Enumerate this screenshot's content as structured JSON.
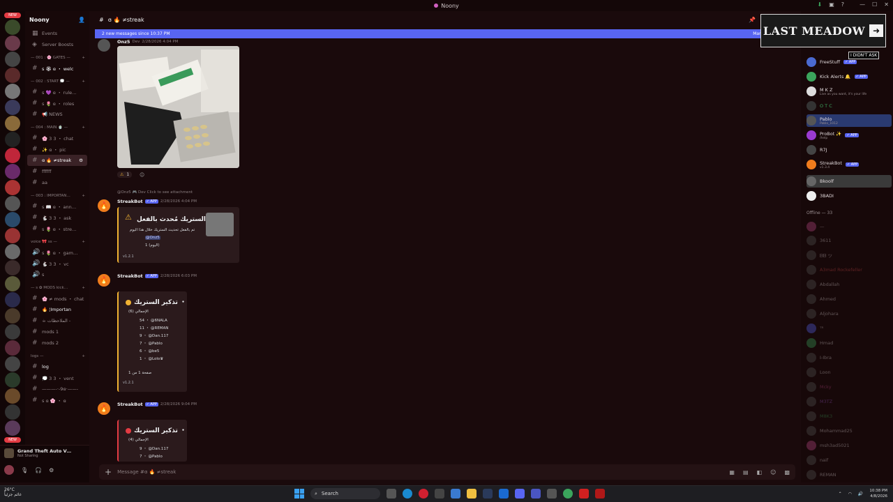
{
  "window": {
    "title": "Noony"
  },
  "guild": {
    "name": "Noony"
  },
  "server_badges": [
    "NEW",
    "NEW"
  ],
  "channels": {
    "top": [
      {
        "label": "Events",
        "icon": "calendar-icon"
      },
      {
        "label": "Server Boosts",
        "icon": "boost-icon"
      }
    ],
    "categories": [
      {
        "name": "— 001 : 🌸 GATES —",
        "items": [
          "ꜱ 🏵 ɞ ・ welc"
        ]
      },
      {
        "name": "— 002 : START 💭 —",
        "items": [
          "ꜱ 💜 ɞ ・ rule…",
          "ꜱ 🌷 ɞ ・ roles",
          "📢 NEWS"
        ]
      },
      {
        "name": "— 004 : MAIN 🍵 —",
        "items": [
          "🌸 3 3 ・ chat",
          "✨ ɞ ・ pic",
          "ɞ 🔥 ≠streak",
          "ffffff",
          "aa"
        ]
      },
      {
        "name": "— 003 : IMPORTAN…",
        "items": [
          "ꜱ 📖 ɞ ・ ann…",
          "🐇 3 3 ・ ask",
          "ꜱ 🌷 ɞ ・ stre…"
        ]
      },
      {
        "name": "voice 🎀 ꜱꜱ —",
        "items": [
          "ꜱ 🌷 ɞ ・ gam…",
          "🐇 3 3 ・ vc",
          "s"
        ]
      },
      {
        "name": "— ꜱ ✿ MODS kick…",
        "items": [
          "🌸 ≠ mods ・ chat",
          "🔥 ¦Importan",
          "☕ الملاحظات -",
          "mods 1",
          "mods 2"
        ]
      },
      {
        "name": "logs —",
        "items": [
          "log",
          "💭 3 3 ・ vent",
          "———-·-9ɞ·——-",
          "ꜱ ɞ 🌸 ・ ɞ"
        ]
      }
    ]
  },
  "user_panel": {
    "game": "Grand Theft Auto V…",
    "status": "Not Sharing"
  },
  "chat": {
    "channel_name": "ɞ 🔥 ≠streak",
    "new_messages_banner": "2 new messages since 10:37 PM",
    "mark_label": "Mark",
    "top_author": "Onz5",
    "top_author_tag": "Dev",
    "top_ts": "2/28/2026 4:04 PM",
    "reaction_count": "1",
    "reply_context": "@Onz5 🎮 Dev  Click to see attachment",
    "messages": [
      {
        "author": "StreakBot",
        "app": "✓ APP",
        "ts": "2/28/2026 4:04 PM",
        "embed_title": "الستريك مُحدث بالفعل ・",
        "lines": [
          "تم بالفعل تحديث الستريك خلال هذا اليوم",
          "@Onz5",
          "1 (اليوم)"
        ],
        "footer": "v1.2.1"
      },
      {
        "author": "StreakBot",
        "app": "✓ APP",
        "ts": "2/28/2026 6:03 PM",
        "embed_title": "تذكير الستريك ・",
        "lines": [
          "(6) الإجمالي",
          "54 ・ @6NALA",
          "11 ・ @REMAN",
          "9 ・ @Dan.117",
          "7 ・ @Pablo",
          "6 ・ @be5",
          "1 ・ @Lolo♛",
          "صفحة 1 من 1"
        ],
        "footer": "v1.2.1"
      },
      {
        "author": "StreakBot",
        "app": "✓ APP",
        "ts": "2/28/2026 9:04 PM",
        "embed_title": "تذكير الستريك ・",
        "lines": [
          "(4) الإجمالي",
          "9 ・ @Dan.117",
          "7 ・ @Pablo"
        ],
        "footer": ""
      }
    ],
    "composer_placeholder": "Message #ɞ 🔥 ≠streak"
  },
  "banner": {
    "text": "LAST MEADOW",
    "subtext": "I DIDN'T ASK"
  },
  "members": {
    "online": [
      {
        "name": "FreeStuff",
        "sub": "",
        "app": "✓ APP"
      },
      {
        "name": "Kick Alerts 🔔",
        "sub": "",
        "app": "✓ APP"
      },
      {
        "name": "M K Z",
        "sub": "Live as you want, it's your life",
        "app": ""
      },
      {
        "name": "O T C",
        "sub": "",
        "app": ""
      },
      {
        "name": "Pablo",
        "sub": "Pablo_1012",
        "app": ""
      },
      {
        "name": "ProBot ✨",
        "sub": "/help",
        "app": "✓ APP"
      },
      {
        "name": "R7J",
        "sub": "",
        "app": ""
      },
      {
        "name": "StreakBot",
        "sub": "v1.3.4",
        "app": "✓ APP"
      },
      {
        "name": "Bkoolf",
        "sub": "",
        "app": ""
      },
      {
        "name": "3BADI",
        "sub": "",
        "app": ""
      }
    ],
    "offline_header": "Offline — 33",
    "offline": [
      "—",
      "3611",
      "ᗷᗷ ツ",
      "A3mad Rockefeller",
      "Abdallah",
      "Ahmed",
      "Aljohara",
      "ᵀᴿ",
      "Hmad",
      "I-Ibra",
      "Loon",
      "Mcky",
      "M3TZ",
      "M8K3",
      "Mohammad25",
      "msh3ad5021",
      "naif",
      "REMAN"
    ]
  },
  "taskbar": {
    "weather_temp": "26°C",
    "weather_desc": "غائم جزئياً",
    "search_label": "Search",
    "time": "10:38 PM",
    "date": "4/8/2026"
  }
}
